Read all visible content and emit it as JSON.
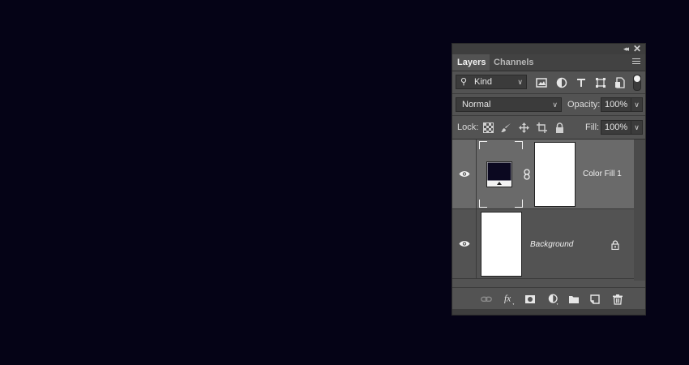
{
  "panel": {
    "tabs": [
      {
        "label": "Layers",
        "active": true
      },
      {
        "label": "Channels",
        "active": false
      }
    ],
    "collapse_glyph": "◂◂",
    "close_glyph": "✕"
  },
  "filter": {
    "kind_label": "Kind",
    "icons": [
      "pixel-layer-filter-icon",
      "adjustment-layer-filter-icon",
      "type-layer-filter-icon",
      "shape-layer-filter-icon",
      "smart-object-filter-icon"
    ],
    "toggle_on": true
  },
  "blend": {
    "mode": "Normal",
    "opacity_label": "Opacity:",
    "opacity_value": "100%"
  },
  "lock": {
    "label": "Lock:",
    "fill_label": "Fill:",
    "fill_value": "100%"
  },
  "layers": [
    {
      "name": "Color Fill 1",
      "type": "adjustment",
      "fill_color": "#0b0820",
      "selected": true,
      "visible": true,
      "linked_mask": true
    },
    {
      "name": "Background",
      "type": "background",
      "selected": false,
      "visible": true,
      "locked": true
    }
  ],
  "bottom_icons": [
    "link-layers-icon",
    "fx-icon",
    "add-mask-icon",
    "new-adjustment-icon",
    "new-group-icon",
    "new-layer-icon",
    "delete-icon"
  ],
  "colors": {
    "canvas": "#050316",
    "panel_bg": "#535353",
    "selected_row": "#6a6a6a"
  }
}
